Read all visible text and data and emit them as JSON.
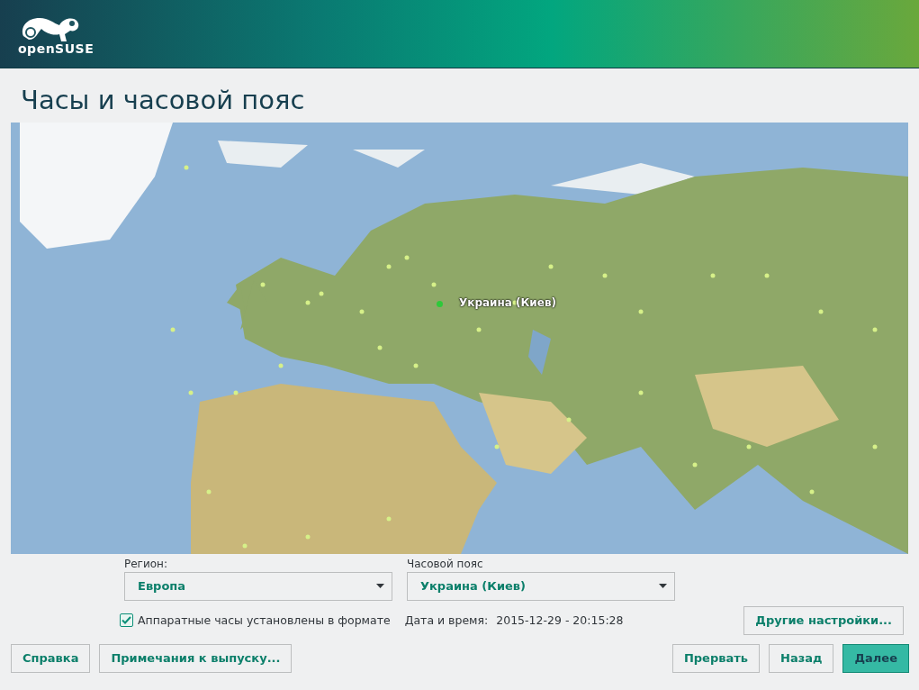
{
  "header": {
    "logo_text": "openSUSE"
  },
  "title": "Часы и часовой пояс",
  "map": {
    "marker_label": "Украина (Киев)"
  },
  "fields": [
    {
      "label": "Регион:",
      "value": "Европа"
    },
    {
      "label": "Часовой пояс",
      "value": "Украина (Киев)"
    }
  ],
  "hardware_clock": {
    "label": "Аппаратные часы установлены в формате",
    "checked": true
  },
  "datetime": {
    "label": "Дата и время:",
    "value": "2015-12-29 - 20:15:28"
  },
  "other_settings": {
    "label": "Другие настройки..."
  },
  "buttons_left": [
    {
      "label": "Справка",
      "primary": false
    },
    {
      "label": "Примечания к выпуску...",
      "primary": false
    }
  ],
  "buttons_right": [
    {
      "label": "Прервать",
      "primary": false
    },
    {
      "label": "Назад",
      "primary": false
    },
    {
      "label": "Далее",
      "primary": true
    }
  ]
}
